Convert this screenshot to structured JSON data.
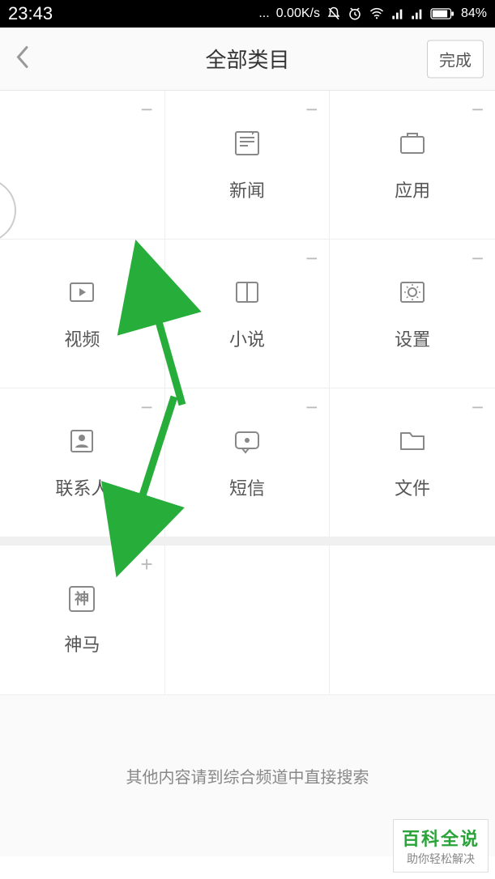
{
  "status": {
    "time": "23:43",
    "speed": "0.00K/s",
    "battery": "84%"
  },
  "header": {
    "title": "全部类目",
    "done": "完成"
  },
  "categories_added": [
    {
      "label": "",
      "icon": "",
      "toggle": "minus"
    },
    {
      "label": "新闻",
      "icon": "news",
      "toggle": "minus"
    },
    {
      "label": "应用",
      "icon": "app",
      "toggle": "minus"
    },
    {
      "label": "视频",
      "icon": "video",
      "toggle": "minus"
    },
    {
      "label": "小说",
      "icon": "book",
      "toggle": "minus"
    },
    {
      "label": "设置",
      "icon": "settings",
      "toggle": "minus"
    },
    {
      "label": "联系人",
      "icon": "contact",
      "toggle": "minus"
    },
    {
      "label": "短信",
      "icon": "message",
      "toggle": "minus"
    },
    {
      "label": "文件",
      "icon": "folder",
      "toggle": "minus"
    }
  ],
  "categories_other": [
    {
      "label": "神马",
      "icon": "shenma",
      "toggle": "plus"
    }
  ],
  "footer": {
    "message": "其他内容请到综合频道中直接搜索"
  },
  "watermark": {
    "title": "百科全说",
    "subtitle": "助你轻松解决"
  }
}
